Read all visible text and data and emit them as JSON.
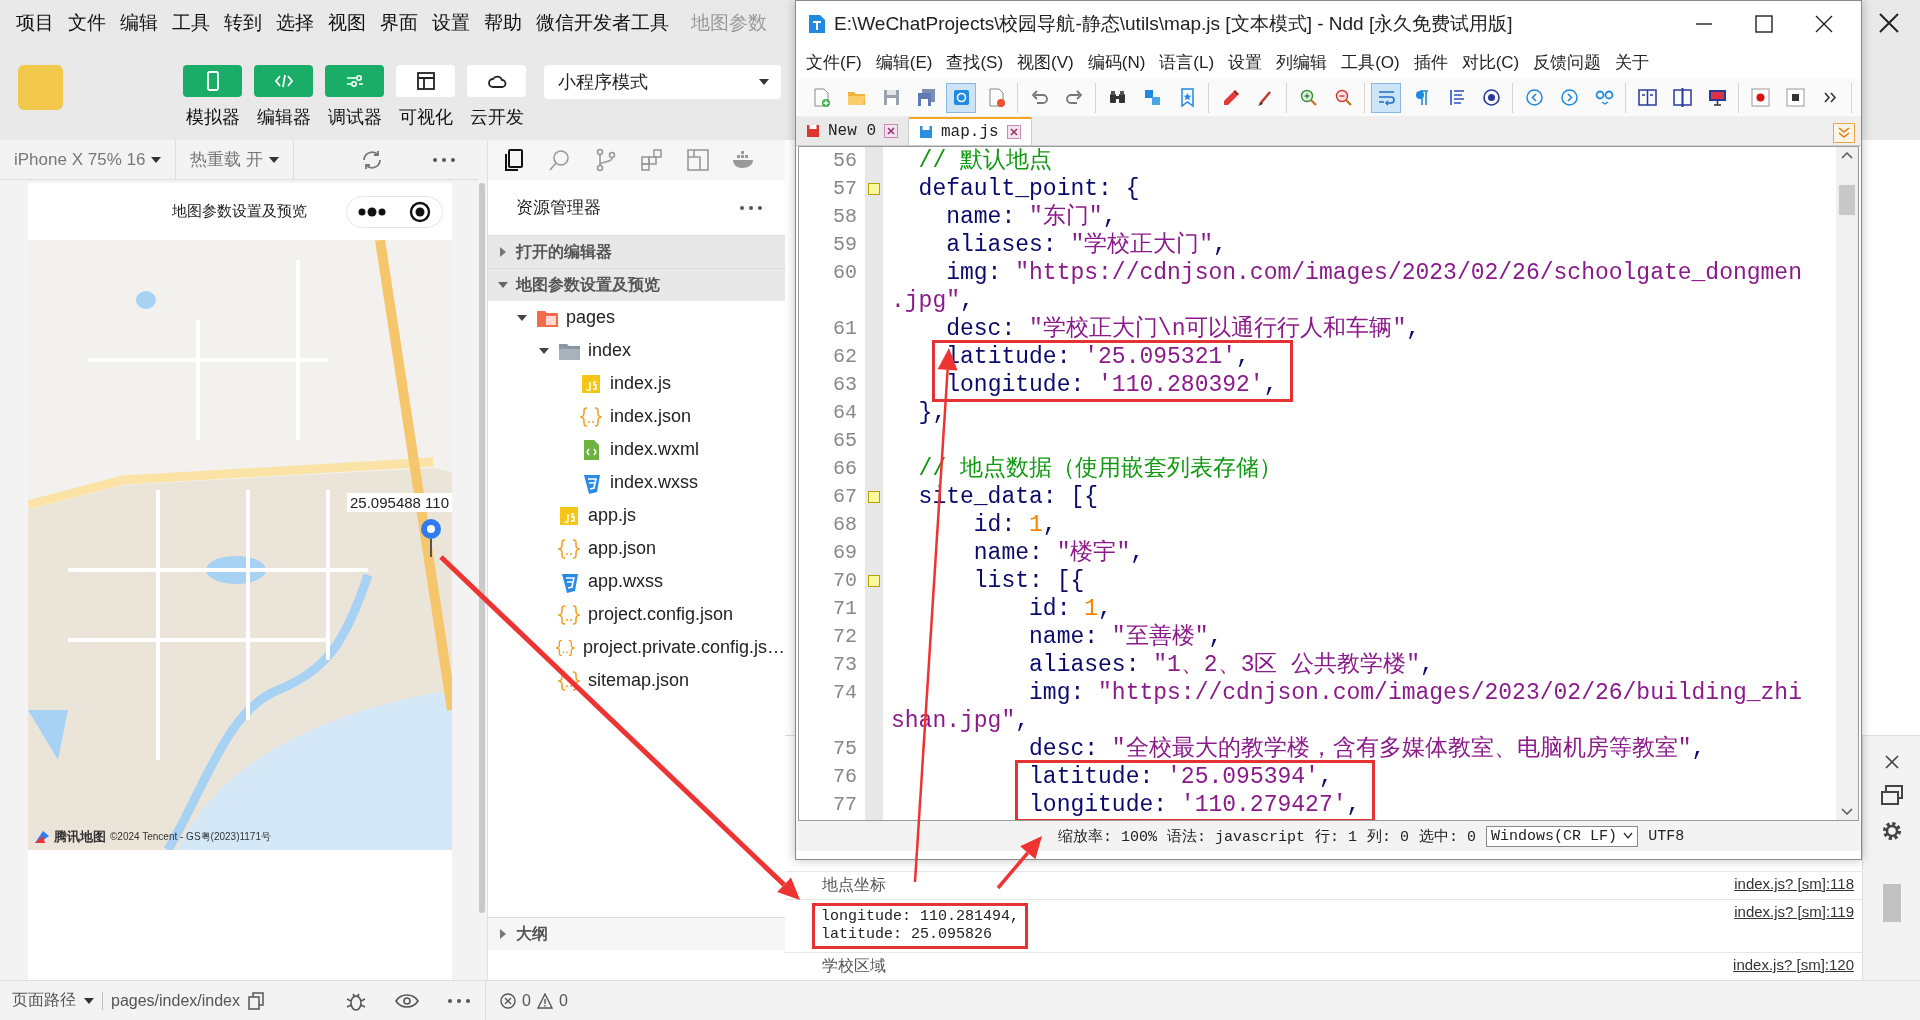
{
  "menu_bar": {
    "items": [
      "项目",
      "文件",
      "编辑",
      "工具",
      "转到",
      "选择",
      "视图",
      "界面",
      "设置",
      "帮助",
      "微信开发者工具"
    ],
    "page_title": "地图参数"
  },
  "toolbar": {
    "buttons": [
      {
        "kind": "phone",
        "label": "模拟器",
        "selected": true
      },
      {
        "kind": "code",
        "label": "编辑器",
        "selected": true
      },
      {
        "kind": "sliders",
        "label": "调试器",
        "selected": true
      },
      {
        "kind": "layout",
        "label": "可视化",
        "selected": false
      },
      {
        "kind": "cloud",
        "label": "云开发",
        "selected": false
      }
    ],
    "mode_select": {
      "value": "小程序模式"
    }
  },
  "simulator": {
    "device": "iPhone X 75% 16",
    "hot_reload": "热重载 开",
    "page_title": "地图参数设置及预览",
    "map": {
      "kind": "picture",
      "callout": "25.095488 110",
      "logo": "腾讯地图",
      "copyright": "©2024 Tencent - GS粤(2023)1171号"
    }
  },
  "explorer": {
    "activity": [
      {
        "kind": "files",
        "selected": true
      },
      {
        "kind": "search",
        "selected": false
      },
      {
        "kind": "branch",
        "selected": false
      },
      {
        "kind": "extensions",
        "selected": false
      },
      {
        "kind": "layout",
        "selected": false
      },
      {
        "kind": "whale",
        "selected": false
      }
    ],
    "title": "资源管理器",
    "sections": [
      {
        "label": "打开的编辑器",
        "expanded": false
      },
      {
        "label": "地图参数设置及预览",
        "expanded": true
      }
    ],
    "tree": [
      {
        "label": "pages",
        "kind": "pages-folder",
        "expanded": true,
        "children": [
          {
            "label": "index",
            "kind": "folder",
            "expanded": true,
            "children": [
              {
                "label": "index.js",
                "kind": "js"
              },
              {
                "label": "index.json",
                "kind": "json"
              },
              {
                "label": "index.wxml",
                "kind": "wxml"
              },
              {
                "label": "index.wxss",
                "kind": "wxss"
              }
            ]
          }
        ]
      },
      {
        "label": "app.js",
        "kind": "js"
      },
      {
        "label": "app.json",
        "kind": "json"
      },
      {
        "label": "app.wxss",
        "kind": "wxss"
      },
      {
        "label": "project.config.json",
        "kind": "json"
      },
      {
        "label": "project.private.config.js…",
        "kind": "json"
      },
      {
        "label": "sitemap.json",
        "kind": "json"
      }
    ],
    "outline": {
      "label": "大纲",
      "expanded": false
    }
  },
  "console": {
    "rows": [
      {
        "lines": [
          "地点坐标"
        ],
        "source": "index.js? [sm]:118",
        "boxed": false,
        "kind": "text"
      },
      {
        "lines": [
          "longitude: 110.281494,",
          "latitude: 25.095826"
        ],
        "source": "index.js? [sm]:119",
        "boxed": true,
        "kind": "object"
      },
      {
        "lines": [
          "学校区域"
        ],
        "source": "index.js? [sm]:120",
        "boxed": false,
        "kind": "text"
      }
    ]
  },
  "status_bar": {
    "path_label": "页面路径",
    "path": "pages/index/index",
    "errors": "0",
    "warnings": "0"
  },
  "editor_window": {
    "title": "E:\\WeChatProjects\\校园导航-静态\\utils\\map.js [文本模式] - Ndd [永久免费试用版]",
    "menu": [
      "文件(F)",
      "编辑(E)",
      "查找(S)",
      "视图(V)",
      "编码(N)",
      "语言(L)",
      "设置",
      "列编辑",
      "工具(O)",
      "插件",
      "对比(C)",
      "反馈问题",
      "关于"
    ],
    "toolbar_groups": [
      [
        {
          "kind": "new",
          "on": false
        },
        {
          "kind": "open",
          "on": false
        },
        {
          "kind": "save",
          "on": false
        },
        {
          "kind": "save-all",
          "on": false
        },
        {
          "kind": "sync",
          "on": true
        },
        {
          "kind": "close-file",
          "on": false
        }
      ],
      [
        {
          "kind": "undo",
          "on": false
        },
        {
          "kind": "redo",
          "on": false
        }
      ],
      [
        {
          "kind": "find",
          "on": false
        },
        {
          "kind": "replace",
          "on": false
        },
        {
          "kind": "bookmark",
          "on": false
        }
      ],
      [
        {
          "kind": "marker",
          "on": false
        },
        {
          "kind": "brush",
          "on": false
        }
      ],
      [
        {
          "kind": "zoom-in",
          "on": false
        },
        {
          "kind": "zoom-out",
          "on": false
        }
      ],
      [
        {
          "kind": "wrap",
          "on": true
        },
        {
          "kind": "pilcrow",
          "on": false
        },
        {
          "kind": "indent",
          "on": false
        },
        {
          "kind": "target",
          "on": false
        }
      ],
      [
        {
          "kind": "prev",
          "on": false
        },
        {
          "kind": "next",
          "on": false
        },
        {
          "kind": "goto",
          "on": false
        }
      ],
      [
        {
          "kind": "split",
          "on": false
        },
        {
          "kind": "compare",
          "on": false
        },
        {
          "kind": "monitor",
          "on": false
        }
      ],
      [
        {
          "kind": "record",
          "on": false
        },
        {
          "kind": "stop",
          "on": false
        },
        {
          "kind": "more",
          "on": false
        }
      ]
    ],
    "tabs": [
      {
        "label": "New 0",
        "selected": false,
        "modified": true
      },
      {
        "label": "map.js",
        "selected": true,
        "modified": false
      }
    ],
    "code": [
      {
        "number": "56",
        "fold": false,
        "tokens": [
          {
            "kind": "comment",
            "text": "  // 默认地点"
          }
        ]
      },
      {
        "number": "57",
        "fold": true,
        "tokens": [
          {
            "kind": "key",
            "text": "  default_point: {"
          }
        ]
      },
      {
        "number": "58",
        "fold": false,
        "tokens": [
          {
            "kind": "key",
            "text": "    name: "
          },
          {
            "kind": "string",
            "text": "\"东门\""
          },
          {
            "kind": "key",
            "text": ","
          }
        ]
      },
      {
        "number": "59",
        "fold": false,
        "tokens": [
          {
            "kind": "key",
            "text": "    aliases: "
          },
          {
            "kind": "string",
            "text": "\"学校正大门\""
          },
          {
            "kind": "key",
            "text": ","
          }
        ]
      },
      {
        "number": "60",
        "fold": false,
        "tokens": [
          {
            "kind": "key",
            "text": "    img: "
          },
          {
            "kind": "string",
            "text": "\"https://cdnjson.com/images/2023/02/26/schoolgate_dongmen"
          }
        ],
        "wrap": [
          {
            "kind": "string",
            "text": ".jpg\""
          },
          {
            "kind": "key",
            "text": ","
          }
        ]
      },
      {
        "number": "61",
        "fold": false,
        "tokens": [
          {
            "kind": "key",
            "text": "    desc: "
          },
          {
            "kind": "string",
            "text": "\"学校正大门\\n可以通行行人和车辆\""
          },
          {
            "kind": "key",
            "text": ","
          }
        ]
      },
      {
        "number": "62",
        "fold": false,
        "boxed": true,
        "tokens": [
          {
            "kind": "key",
            "text": "    latitude: "
          },
          {
            "kind": "string",
            "text": "'25.095321'"
          },
          {
            "kind": "key",
            "text": ","
          }
        ]
      },
      {
        "number": "63",
        "fold": false,
        "boxed": true,
        "tokens": [
          {
            "kind": "key",
            "text": "    longitude: "
          },
          {
            "kind": "string",
            "text": "'110.280392'"
          },
          {
            "kind": "key",
            "text": ","
          }
        ]
      },
      {
        "number": "64",
        "fold": false,
        "tokens": [
          {
            "kind": "key",
            "text": "  },"
          }
        ]
      },
      {
        "number": "65",
        "fold": false
      },
      {
        "number": "66",
        "fold": false,
        "tokens": [
          {
            "kind": "comment",
            "text": "  // 地点数据（使用嵌套列表存储）"
          }
        ]
      },
      {
        "number": "67",
        "fold": true,
        "tokens": [
          {
            "kind": "key",
            "text": "  site_data: [{"
          }
        ]
      },
      {
        "number": "68",
        "fold": false,
        "tokens": [
          {
            "kind": "key",
            "text": "      id: "
          },
          {
            "kind": "number",
            "text": "1"
          },
          {
            "kind": "key",
            "text": ","
          }
        ]
      },
      {
        "number": "69",
        "fold": false,
        "tokens": [
          {
            "kind": "key",
            "text": "      name: "
          },
          {
            "kind": "string",
            "text": "\"楼宇\""
          },
          {
            "kind": "key",
            "text": ","
          }
        ]
      },
      {
        "number": "70",
        "fold": true,
        "tokens": [
          {
            "kind": "key",
            "text": "      list: [{"
          }
        ]
      },
      {
        "number": "71",
        "fold": false,
        "tokens": [
          {
            "kind": "key",
            "text": "          id: "
          },
          {
            "kind": "number",
            "text": "1"
          },
          {
            "kind": "key",
            "text": ","
          }
        ]
      },
      {
        "number": "72",
        "fold": false,
        "tokens": [
          {
            "kind": "key",
            "text": "          name: "
          },
          {
            "kind": "string",
            "text": "\"至善楼\""
          },
          {
            "kind": "key",
            "text": ","
          }
        ]
      },
      {
        "number": "73",
        "fold": false,
        "tokens": [
          {
            "kind": "key",
            "text": "          aliases: "
          },
          {
            "kind": "string",
            "text": "\"1、2、3区 公共教学楼\""
          },
          {
            "kind": "key",
            "text": ","
          }
        ]
      },
      {
        "number": "74",
        "fold": false,
        "tokens": [
          {
            "kind": "key",
            "text": "          img: "
          },
          {
            "kind": "string",
            "text": "\"https://cdnjson.com/images/2023/02/26/building_zhi"
          }
        ],
        "wrap": [
          {
            "kind": "string",
            "text": "shan.jpg\""
          },
          {
            "kind": "key",
            "text": ","
          }
        ]
      },
      {
        "number": "75",
        "fold": false,
        "tokens": [
          {
            "kind": "key",
            "text": "          desc: "
          },
          {
            "kind": "string",
            "text": "\"全校最大的教学楼，含有多媒体教室、电脑机房等教室\""
          },
          {
            "kind": "key",
            "text": ","
          }
        ]
      },
      {
        "number": "76",
        "fold": false,
        "boxed": true,
        "tokens": [
          {
            "kind": "key",
            "text": "          latitude: "
          },
          {
            "kind": "string",
            "text": "'25.095394'"
          },
          {
            "kind": "key",
            "text": ","
          }
        ]
      },
      {
        "number": "77",
        "fold": false,
        "boxed": true,
        "tokens": [
          {
            "kind": "key",
            "text": "          longitude: "
          },
          {
            "kind": "string",
            "text": "'110.279427'"
          },
          {
            "kind": "key",
            "text": ","
          }
        ]
      }
    ],
    "status": {
      "zoom": "缩放率: 100%",
      "syntax": "语法: javascript",
      "line": "行: 1",
      "column": "列: 0",
      "selection": "选中: 0",
      "line_ending": "Windows(CR LF)",
      "encoding": "UTF8"
    }
  },
  "annotations": [
    {
      "kind": "arrow"
    },
    {
      "kind": "arrow"
    },
    {
      "kind": "arrow"
    }
  ]
}
